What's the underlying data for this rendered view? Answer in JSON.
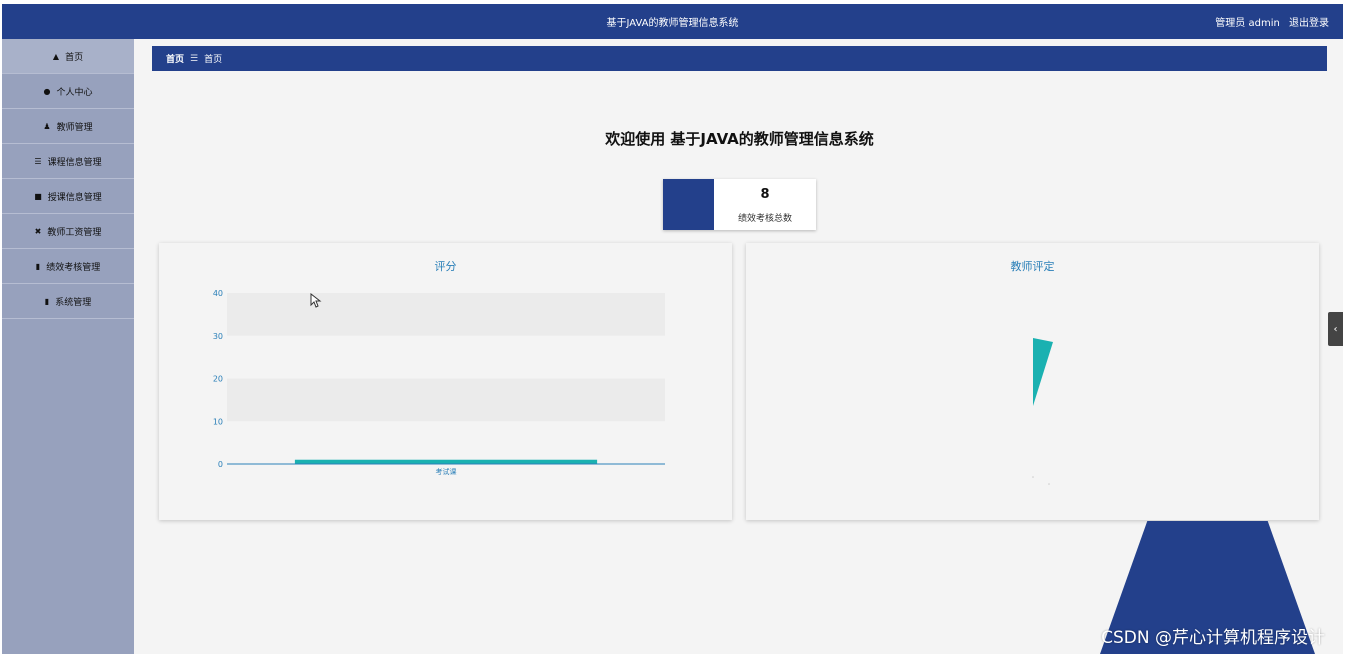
{
  "header": {
    "title": "基于JAVA的教师管理信息系统",
    "user": "管理员 admin",
    "logout": "退出登录"
  },
  "sidebar": {
    "items": [
      {
        "label": "首页",
        "icon": "home-icon"
      },
      {
        "label": "个人中心",
        "icon": "user-icon"
      },
      {
        "label": "教师管理",
        "icon": "teacher-icon"
      },
      {
        "label": "课程信息管理",
        "icon": "list-icon"
      },
      {
        "label": "授课信息管理",
        "icon": "monitor-icon"
      },
      {
        "label": "教师工资管理",
        "icon": "money-icon"
      },
      {
        "label": "绩效考核管理",
        "icon": "clipboard-icon"
      },
      {
        "label": "系统管理",
        "icon": "settings-icon"
      }
    ]
  },
  "breadcrumb": {
    "home": "首页",
    "separator": "☰",
    "current": "首页"
  },
  "welcome": "欢迎使用 基于JAVA的教师管理信息系统",
  "stat": {
    "value": "8",
    "label": "绩效考核总数"
  },
  "cards": {
    "score_title": "评分",
    "rating_title": "教师评定"
  },
  "chart_data": [
    {
      "type": "bar",
      "title": "评分",
      "categories": [
        "考试课"
      ],
      "values": [
        1
      ],
      "ylim": [
        0,
        40
      ],
      "yticks": [
        0,
        10,
        20,
        30,
        40
      ],
      "grid": true,
      "color": "#1ab1b1"
    },
    {
      "type": "pie",
      "title": "教师评定",
      "color": "#1ab1b1"
    }
  ],
  "colors": {
    "primary": "#23408b",
    "accent": "#1ab1b1",
    "sidebar": "#97a1bd"
  },
  "watermark": "CSDN @芹心计算机程序设计"
}
